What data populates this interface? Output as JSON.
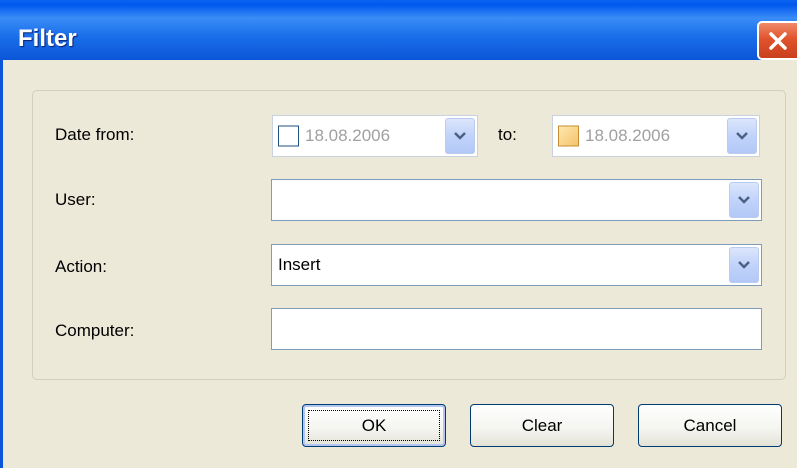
{
  "window": {
    "title": "Filter"
  },
  "form": {
    "date_from_label": "Date from:",
    "date_from_value": "18.08.2006",
    "to_label": "to:",
    "date_to_value": "18.08.2006",
    "user_label": "User:",
    "user_value": "",
    "action_label": "Action:",
    "action_value": "Insert",
    "computer_label": "Computer:",
    "computer_value": ""
  },
  "buttons": {
    "ok": "OK",
    "clear": "Clear",
    "cancel": "Cancel"
  },
  "colors": {
    "titlebar": "#0058EE",
    "face": "#ECE9D8",
    "field_border": "#7F9DB9",
    "close": "#E0532C"
  },
  "icons": {
    "close": "close-icon",
    "dropdown": "chevron-down-icon"
  }
}
